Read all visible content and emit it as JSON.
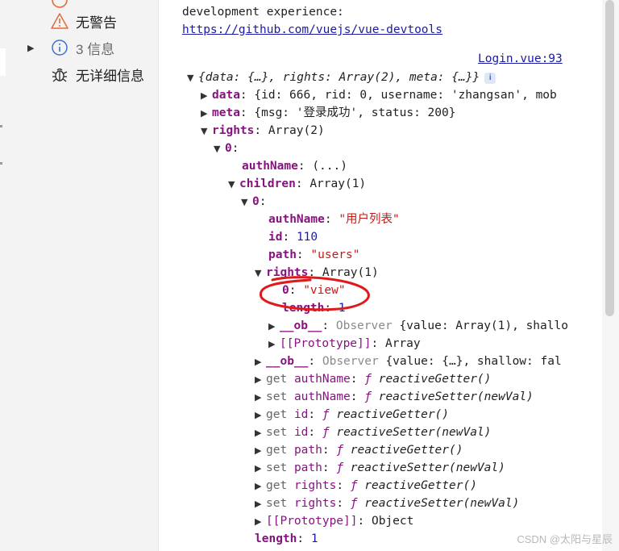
{
  "sidebar": {
    "items": [
      {
        "label": "无警告",
        "icon": "warning-icon",
        "has_arrow": false,
        "muted": false
      },
      {
        "label": "3 信息",
        "icon": "info-icon",
        "has_arrow": true,
        "muted": true
      },
      {
        "label": "无详细信息",
        "icon": "bug-icon",
        "has_arrow": false,
        "muted": false
      }
    ]
  },
  "console": {
    "message_text": "development experience:",
    "message_link": "https://github.com/vuejs/vue-devtools",
    "source_link": "Login.vue:93",
    "root_summary": "{data: {…}, rights: Array(2), meta: {…}}",
    "data_key": "data",
    "data_preview": "{id: 666, rid: 0, username: 'zhangsan', mob",
    "meta_key": "meta",
    "meta_preview": "{msg: '登录成功', status: 200}",
    "rights_key": "rights",
    "rights_preview": "Array(2)",
    "idx0": "0",
    "authname_key": "authName",
    "authname_collapsed": "(...)",
    "children_key": "children",
    "children_preview": "Array(1)",
    "child_idx": "0",
    "child_authname_val": "\"用户列表\"",
    "id_key": "id",
    "id_val": "110",
    "path_key": "path",
    "path_val": "\"users\"",
    "inner_rights_key": "rights",
    "inner_rights_preview": "Array(1)",
    "inner0_val": "\"view\"",
    "length_key": "length",
    "length_val_inner": "1",
    "ob_key": "__ob__",
    "observer_word": "Observer",
    "ob_preview_array": "{value: Array(1), shallo",
    "proto_key": "[[Prototype]]",
    "proto_array": "Array",
    "ob_preview_obj": "{value: {…}, shallow: fal",
    "get_word": "get",
    "set_word": "set",
    "f_symbol": "ƒ",
    "getter_name": "reactiveGetter()",
    "setter_name": "reactiveSetter(newVal)",
    "proto_object": "Object",
    "length_val_outer": "1"
  },
  "watermark": "CSDN @太阳与星辰",
  "colors": {
    "annotation": "#e0191b",
    "key": "#881280",
    "string": "#c41a16",
    "number": "#1a1aa6"
  }
}
